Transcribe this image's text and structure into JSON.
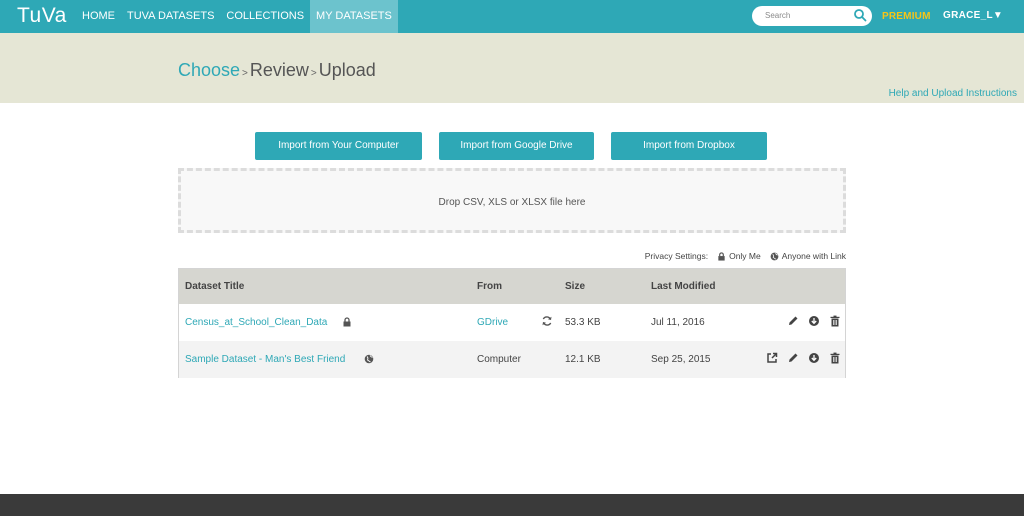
{
  "nav": {
    "logo": "TuVa",
    "items": [
      {
        "label": "HOME",
        "active": false
      },
      {
        "label": "TUVA DATASETS",
        "active": false
      },
      {
        "label": "COLLECTIONS",
        "active": false
      },
      {
        "label": "MY DATASETS",
        "active": true
      }
    ],
    "search_placeholder": "Search",
    "premium": "PREMIUM",
    "user": "GRACE_L▼"
  },
  "steps": {
    "choose": "Choose",
    "sep1": ">",
    "review": "Review",
    "sep2": ">",
    "upload": "Upload",
    "help": "Help and Upload Instructions"
  },
  "import": {
    "computer": "Import from Your Computer",
    "google": "Import from Google Drive",
    "dropbox": "Import from Dropbox",
    "drop_text": "Drop CSV, XLS or XLSX file here"
  },
  "privacy": {
    "label": "Privacy Settings:",
    "only_me": "Only Me",
    "anyone": "Anyone with Link"
  },
  "table": {
    "headers": {
      "title": "Dataset Title",
      "from": "From",
      "size": "Size",
      "modified": "Last Modified"
    },
    "rows": [
      {
        "title": "Census_at_School_Clean_Data",
        "privacy": "lock-icon",
        "from": "GDrive",
        "size": "53.3 KB",
        "modified": "Jul 11, 2016"
      },
      {
        "title": "Sample Dataset - Man's Best Friend",
        "privacy": "globe-icon",
        "from": "Computer",
        "size": "12.1 KB",
        "modified": "Sep 25, 2015"
      }
    ]
  },
  "colors": {
    "brand": "#2ea8b6",
    "premium": "#f5c518",
    "band": "#e5e6d5"
  }
}
